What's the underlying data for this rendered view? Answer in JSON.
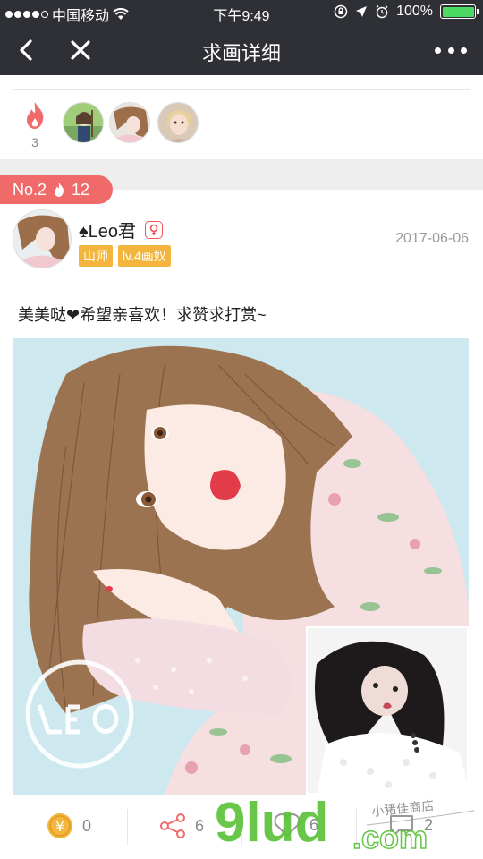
{
  "status_bar": {
    "carrier": "中国移动",
    "time": "下午9:49",
    "battery_percent": "100%",
    "battery_level": 1.0
  },
  "nav": {
    "title": "求画详细"
  },
  "likers": {
    "count": "3"
  },
  "post": {
    "rank": "No.2",
    "fire_count": "12",
    "user_name": "♠Leo君",
    "tags": [
      "山师",
      "lv.4画奴"
    ],
    "date": "2017-06-06",
    "text": "美美哒❤希望亲喜欢！求赞求打赏~"
  },
  "actions": {
    "coin": "0",
    "share": "6",
    "like": "6",
    "comment": "2"
  },
  "watermark": {
    "brand": "9lud",
    "domain": ".com",
    "handwriting": "小猪佳商店"
  },
  "colors": {
    "header_bg": "#2f3035",
    "accent_red": "#f06a6a",
    "tag_yellow": "#f3b53d",
    "watermark_green": "#5cc33a"
  }
}
